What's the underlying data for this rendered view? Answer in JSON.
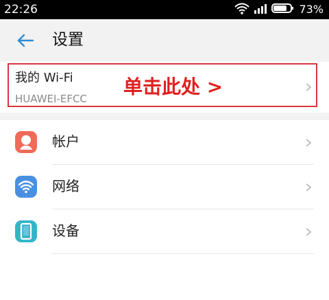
{
  "statusbar": {
    "time": "22:26",
    "battery": "73%"
  },
  "header": {
    "title": "设置"
  },
  "wifi_card": {
    "title": "我的 Wi-Fi",
    "ssid": "HUAWEI-EFCC",
    "hint": "单击此处 >"
  },
  "settings": [
    {
      "label": "帐户",
      "icon": "account-icon",
      "color": "#ef6b58"
    },
    {
      "label": "网络",
      "icon": "wifi-icon",
      "color": "#4a90e2"
    },
    {
      "label": "设备",
      "icon": "device-icon",
      "color": "#33b5c8"
    }
  ],
  "colors": {
    "highlight": "#d9363e",
    "hint": "#e02020",
    "accent": "#2b8cd6"
  }
}
